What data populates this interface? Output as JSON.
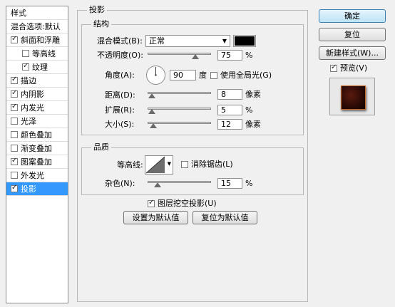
{
  "style_list": {
    "header": "样式",
    "blending_options": "混合选项:默认",
    "items": [
      {
        "label": "斜面和浮雕",
        "checked": true
      },
      {
        "label": "等高线",
        "checked": false
      },
      {
        "label": "纹理",
        "checked": true
      },
      {
        "label": "描边",
        "checked": true
      },
      {
        "label": "内阴影",
        "checked": true
      },
      {
        "label": "内发光",
        "checked": true
      },
      {
        "label": "光泽",
        "checked": false
      },
      {
        "label": "颜色叠加",
        "checked": false
      },
      {
        "label": "渐变叠加",
        "checked": false
      },
      {
        "label": "图案叠加",
        "checked": true
      },
      {
        "label": "外发光",
        "checked": false
      },
      {
        "label": "投影",
        "checked": true
      }
    ]
  },
  "drop_shadow": {
    "title": "投影",
    "structure": {
      "title": "结构",
      "blend_mode_label": "混合模式(B):",
      "blend_mode_value": "正常",
      "shadow_color": "#000000",
      "opacity_label": "不透明度(O):",
      "opacity_value": "75",
      "opacity_unit": "%",
      "opacity_level": 0.75,
      "angle_label": "角度(A):",
      "angle_value": "90",
      "angle_unit": "度",
      "global_light_label": "使用全局光(G)",
      "global_light_checked": false,
      "distance_label": "距离(D):",
      "distance_value": "8",
      "distance_unit": "像素",
      "spread_label": "扩展(R):",
      "spread_value": "5",
      "spread_unit": "%",
      "size_label": "大小(S):",
      "size_value": "12",
      "size_unit": "像素"
    },
    "quality": {
      "title": "品质",
      "contour_label": "等高线:",
      "anti_alias_label": "消除锯齿(L)",
      "anti_alias_checked": false,
      "noise_label": "杂色(N):",
      "noise_value": "15",
      "noise_unit": "%"
    },
    "knockout_label": "图层挖空投影(U)",
    "knockout_checked": true,
    "make_default_label": "设置为默认值",
    "reset_default_label": "复位为默认值"
  },
  "buttons": {
    "ok": "确定",
    "reset": "复位",
    "new_style": "新建样式(W)...",
    "preview_label": "预览(V)",
    "preview_checked": true
  }
}
